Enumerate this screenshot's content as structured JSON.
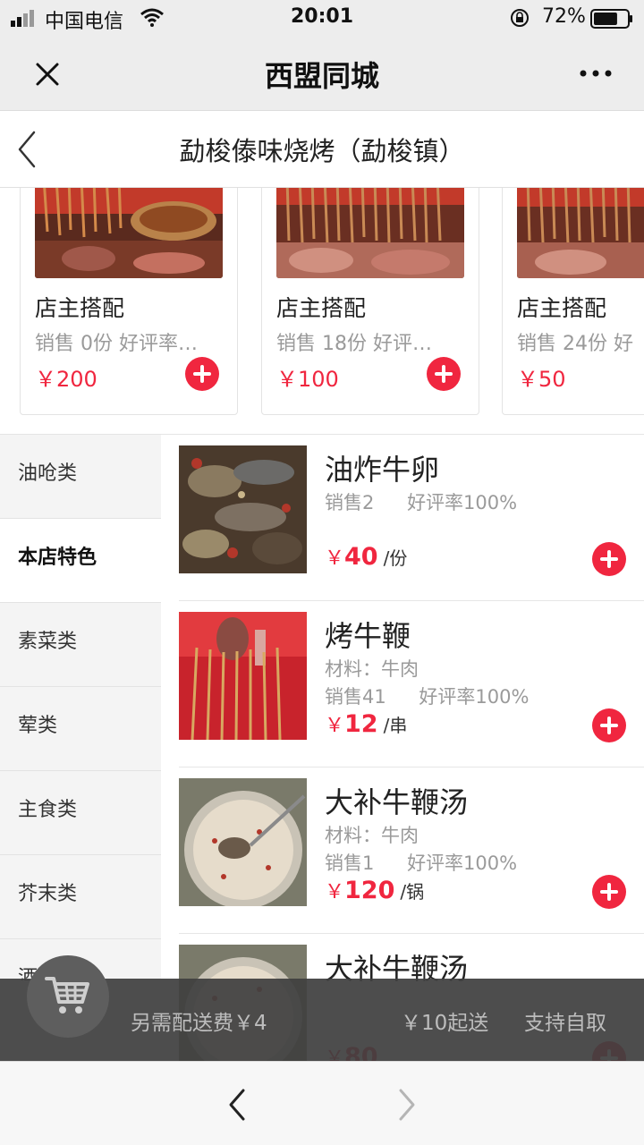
{
  "status_bar": {
    "carrier": "中国电信",
    "time": "20:01",
    "battery_percent": "72%",
    "battery_level": 0.72
  },
  "nav_bar": {
    "title": "西盟同城"
  },
  "page": {
    "title": "勐梭傣味烧烤（勐梭镇）"
  },
  "combos": [
    {
      "name": "店主搭配",
      "stats": "销售   0份   好评率…",
      "price": "￥200"
    },
    {
      "name": "店主搭配",
      "stats": "销售   18份   好评…",
      "price": "￥100"
    },
    {
      "name": "店主搭配",
      "stats": "销售   24份   好",
      "price": "￥50"
    }
  ],
  "categories": [
    {
      "label": "油呛类"
    },
    {
      "label": "本店特色",
      "active": true
    },
    {
      "label": "素菜类"
    },
    {
      "label": "荤类"
    },
    {
      "label": "主食类"
    },
    {
      "label": "芥末类"
    },
    {
      "label": "酒"
    }
  ],
  "dishes": [
    {
      "name": "油炸牛卵",
      "material": "",
      "sales": "销售2",
      "rating": "好评率100%",
      "yen": "￥",
      "price": "40",
      "unit": "/份"
    },
    {
      "name": "烤牛鞭",
      "material": "材料：牛肉",
      "sales": "销售41",
      "rating": "好评率100%",
      "yen": "￥",
      "price": "12",
      "unit": "/串"
    },
    {
      "name": "大补牛鞭汤",
      "material": "材料：牛肉",
      "sales": "销售1",
      "rating": "好评率100%",
      "yen": "￥",
      "price": "120",
      "unit": "/锅"
    },
    {
      "name": "大补牛鞭汤",
      "material": "",
      "sales": "",
      "rating": "",
      "yen": "￥",
      "price": "80",
      "unit": ""
    }
  ],
  "cart_bar": {
    "delivery_fee": "另需配送费￥4",
    "min_order": "￥10起送",
    "self_pickup": "支持自取"
  },
  "icons": {
    "accent": "#f0263f"
  }
}
